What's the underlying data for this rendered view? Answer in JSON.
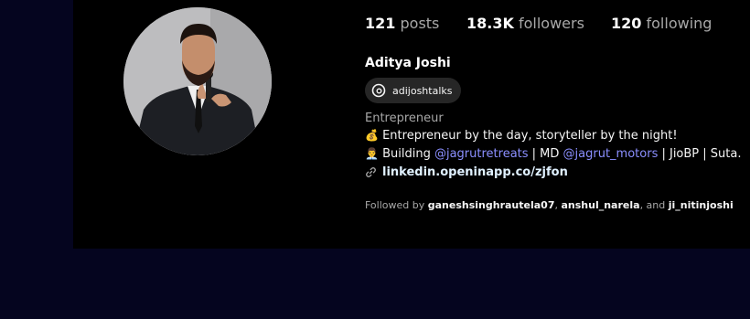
{
  "stats": {
    "posts_count": "121",
    "posts_label": "posts",
    "followers_count": "18.3K",
    "followers_label": "followers",
    "following_count": "120",
    "following_label": "following"
  },
  "profile": {
    "name": "Aditya Joshi",
    "threads_handle": "adijoshtalks",
    "category": "Entrepreneur",
    "bio_line1_emoji": "💰",
    "bio_line1_text": "Entrepreneur by the day, storyteller by the night!",
    "bio_line2_emoji": "👨‍💼",
    "bio_line2_prefix": "Building ",
    "bio_line2_mention1": "@jagrutretreats",
    "bio_line2_mid": " | MD ",
    "bio_line2_mention2": "@jagrut_motors",
    "bio_line2_suffix": " | JioBP | Suta.",
    "link": "linkedin.openinapp.co/zjfon"
  },
  "followed_by": {
    "prefix": "Followed by ",
    "user1": "ganeshsinghrautela07",
    "sep1": ", ",
    "user2": "anshul_narela",
    "sep2": ", and ",
    "user3": "ji_nitinjoshi"
  }
}
